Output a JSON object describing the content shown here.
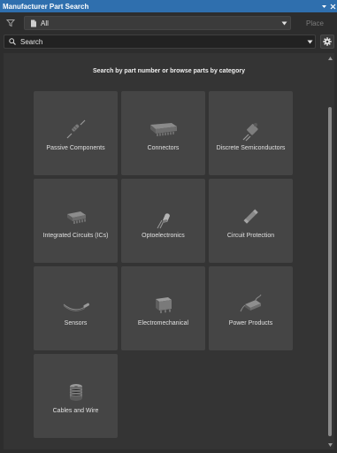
{
  "window": {
    "title": "Manufacturer Part Search",
    "pin_icon": "pin-dropdown-icon",
    "close_icon": "close-icon"
  },
  "toolbar": {
    "filter_icon": "filter-icon",
    "scope_value": "All",
    "place_label": "Place"
  },
  "search": {
    "placeholder": "Search",
    "value": ""
  },
  "content": {
    "hint": "Search by part number or browse parts by category",
    "categories": [
      {
        "label": "Passive Components",
        "icon": "resistor-icon"
      },
      {
        "label": "Connectors",
        "icon": "connector-icon"
      },
      {
        "label": "Discrete Semiconductors",
        "icon": "transistor-icon"
      },
      {
        "label": "Integrated Circuits (ICs)",
        "icon": "ic-chip-icon"
      },
      {
        "label": "Optoelectronics",
        "icon": "led-icon"
      },
      {
        "label": "Circuit Protection",
        "icon": "fuse-icon"
      },
      {
        "label": "Sensors",
        "icon": "sensor-probe-icon"
      },
      {
        "label": "Electromechanical",
        "icon": "relay-icon"
      },
      {
        "label": "Power Products",
        "icon": "power-adapter-icon"
      },
      {
        "label": "Cables and Wire",
        "icon": "cable-spool-icon"
      }
    ]
  },
  "colors": {
    "titlebar": "#2f6fae",
    "panel_bg": "#2d2d2d",
    "content_bg": "#343434",
    "tile_bg": "#454545"
  }
}
